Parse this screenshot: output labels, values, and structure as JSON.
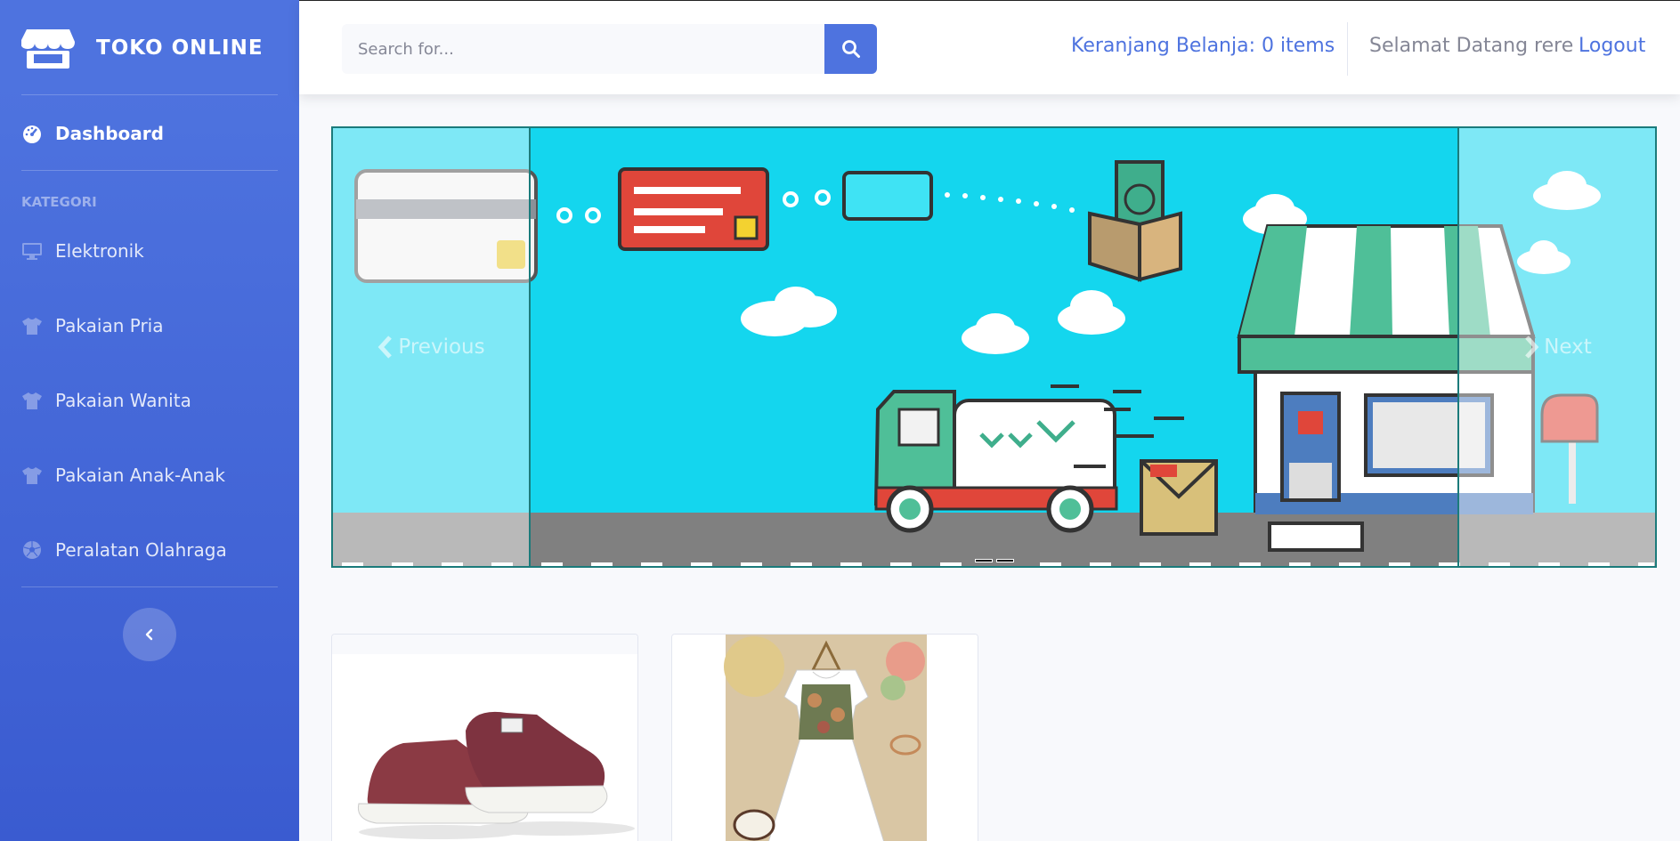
{
  "sidebar": {
    "brand": "TOKO ONLINE",
    "brand_icon": "store-icon",
    "dashboard": "Dashboard",
    "section_heading": "KATEGORI",
    "categories": [
      {
        "label": "Elektronik",
        "icon": "desktop-icon"
      },
      {
        "label": "Pakaian Pria",
        "icon": "tshirt-icon"
      },
      {
        "label": "Pakaian Wanita",
        "icon": "tshirt-icon"
      },
      {
        "label": "Pakaian Anak-Anak",
        "icon": "tshirt-icon"
      },
      {
        "label": "Peralatan Olahraga",
        "icon": "futbol-icon"
      }
    ],
    "toggle_icon": "chevron-left-icon"
  },
  "topbar": {
    "search_placeholder": "Search for...",
    "search_icon": "search-icon",
    "cart": "Keranjang Belanja: 0 items",
    "welcome": "Selamat Datang rere",
    "logout": "Logout"
  },
  "carousel": {
    "prev_label": "Previous",
    "next_label": "Next",
    "slide_count": 2,
    "active_slide": 1
  },
  "products": [
    {
      "image": "red-sneakers"
    },
    {
      "image": "girls-floral-dress"
    }
  ],
  "colors": {
    "primary": "#4e73df",
    "sidebar_gradient_end": "#3a5bd0",
    "page_bg": "#f8f9fc",
    "slide_bg": "#14d6ee"
  }
}
